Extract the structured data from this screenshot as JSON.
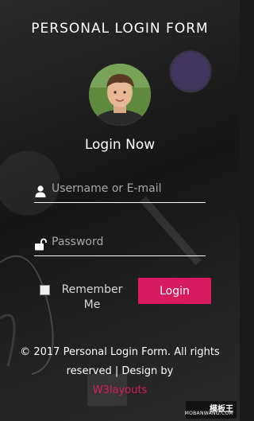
{
  "header": {
    "title": "PERSONAL LOGIN FORM"
  },
  "form": {
    "heading": "Login Now",
    "username": {
      "value": "",
      "placeholder": "Username or E-mail",
      "icon": "user-icon"
    },
    "password": {
      "value": "",
      "placeholder": "Password",
      "icon": "lock-icon"
    },
    "remember_label": "Remember Me",
    "remember_checked": false,
    "submit_label": "Login"
  },
  "footer": {
    "text": "© 2017 Personal Login Form. All rights reserved | Design by",
    "link_label": "W3layouts"
  },
  "watermark": {
    "brand": "模板王",
    "site": "MOBANWANG.COM"
  },
  "colors": {
    "accent": "#d81b60",
    "text": "#ffffff",
    "placeholder": "#a8a8a8"
  }
}
